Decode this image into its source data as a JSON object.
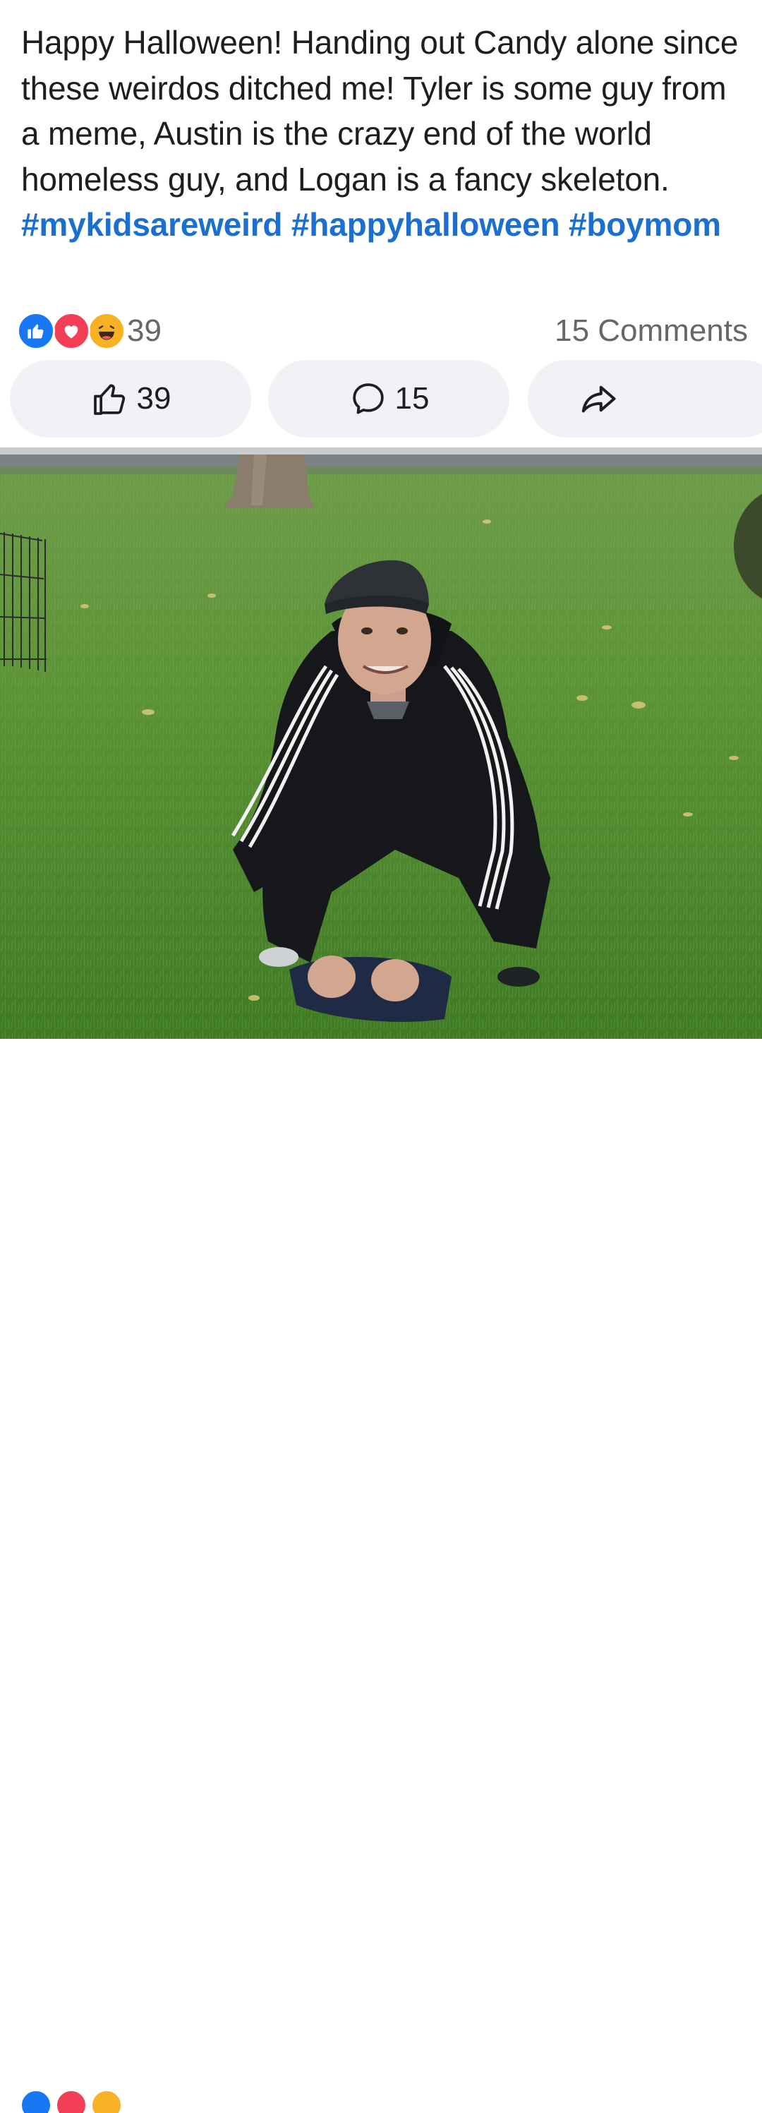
{
  "post": {
    "text": "Happy Halloween! Handing out Candy alone since these weirdos ditched me! Tyler is some guy from a meme, Austin is the crazy end of the world homeless guy, and Logan is a fancy skeleton.",
    "hashtags": [
      "#mykidsareweird",
      "#happyhalloween",
      "#boymom"
    ]
  },
  "reactions": {
    "icons": [
      "like-icon",
      "love-icon",
      "haha-icon"
    ],
    "count": "39"
  },
  "comments_summary": "15 Comments",
  "actions": {
    "like_count": "39",
    "comment_count": "15"
  },
  "colors": {
    "hashtag": "#1b6fd1",
    "like": "#1877f2",
    "love": "#f33e58",
    "haha": "#f7b125",
    "button_bg": "#f0f2f5"
  }
}
